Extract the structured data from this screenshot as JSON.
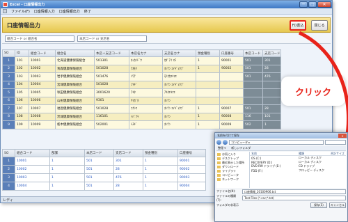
{
  "window": {
    "title": "Excel - 口座情報出力",
    "controls": [
      "─",
      "□",
      "✕"
    ]
  },
  "menu": [
    "ファイル(F)",
    "口座情報入力",
    "口座情報出力",
    "終了"
  ],
  "header": {
    "title": "口座情報出力",
    "fd_button": "FD書込",
    "close_button": "閉じる"
  },
  "search": {
    "union_label": "組合コード or 組合名",
    "branch_label": "本店コード or 支店名"
  },
  "grid1": {
    "columns": [
      "SO",
      "ID",
      "組合コード",
      "組合名",
      "本店＋支店コード",
      "本店名カナ",
      "支店名カナ",
      "預金種別",
      "口座番号",
      "本店コード",
      "支店コード"
    ],
    "rows": [
      [
        "1",
        "101",
        "10001",
        "北海道健康保険組合",
        "501301",
        "ﾎｯｶｲﾄﾞｳ",
        "ｶﾀﾞｱｲ ﾏﾁ",
        "1",
        "90001",
        "501",
        "301"
      ],
      [
        "2",
        "102",
        "10002",
        "青森健康保険組合",
        "501028",
        "ｱｵﾓﾘ",
        "ﾎﾝﾃﾝ ｴｲｷﾞｮｳﾌﾞ",
        "1",
        "90002",
        "501",
        "28"
      ],
      [
        "3",
        "103",
        "10003",
        "岩手健康保険組合",
        "501476",
        "ｲﾜﾃ",
        "ﾓﾘｵｶｴｷﾏｴ",
        "",
        "",
        "501",
        "476"
      ],
      [
        "4",
        "104",
        "10004",
        "宮城健康保険組合",
        "501028",
        "ﾐﾔｷﾞ",
        "ﾎﾝﾃﾝ ｴｲｷﾞｮｳﾌﾞ",
        "",
        "",
        "",
        ""
      ],
      [
        "5",
        "105",
        "10005",
        "秋田健康保険組合",
        "3001620",
        "ｱｷﾀ",
        "ｱｷﾀｴｷﾏｴ",
        "",
        "",
        "",
        ""
      ],
      [
        "6",
        "106",
        "10006",
        "山形健康保険組合",
        "9301",
        "ﾔﾏｶﾞﾀ",
        "ﾎﾝﾃﾝ",
        "",
        "",
        "",
        ""
      ],
      [
        "7",
        "107",
        "10007",
        "福島健康保険組合",
        "501028",
        "ﾌｸｼﾏ",
        "ﾎﾝﾃﾝ ｴｲｷﾞｮｳﾌﾞ",
        "1",
        "90007",
        "501",
        "28"
      ],
      [
        "8",
        "108",
        "10008",
        "茨城健康保険組合",
        "116101",
        "ｲﾊﾞﾗｷ",
        "ﾎﾝﾃﾝ",
        "1",
        "90008",
        "116",
        "101"
      ],
      [
        "9",
        "109",
        "10009",
        "栃木健康保険組合",
        "502001",
        "ﾄﾁｷﾞ",
        "ﾎﾝﾃﾝ",
        "1",
        "90009",
        "502",
        "1"
      ]
    ]
  },
  "grid2": {
    "columns": [
      "SO",
      "組合コード",
      "部課",
      "本店コード",
      "支店コード",
      "預金種別",
      "口座番号"
    ],
    "rows": [
      [
        "1",
        "10001",
        "1",
        "501",
        "301",
        "1",
        "90001"
      ],
      [
        "2",
        "10002",
        "1",
        "501",
        "28",
        "1",
        "90002"
      ],
      [
        "3",
        "10003",
        "1",
        "501",
        "476",
        "1",
        "90003"
      ],
      [
        "4",
        "10004",
        "1",
        "501",
        "28",
        "1",
        "90004"
      ]
    ]
  },
  "status": "レディ",
  "callout": "クリック",
  "dialog": {
    "title": "名前を付けて保存",
    "close": "✕",
    "address": "コンピュータ ▸",
    "toolbar": [
      "整理 ▾",
      "新しいフォルダ"
    ],
    "nav_items": [
      "お気に入り",
      "デスクトップ",
      "最近表示した場所",
      "ダウンロード",
      "ライブラリ",
      "コンピュータ",
      "ネットワーク"
    ],
    "list_headers": [
      "名前",
      "種類",
      "合計サイズ"
    ],
    "list_rows": [
      [
        "OS (C:)",
        "ローカル ディスク",
        ""
      ],
      [
        "RECOVERY (D:)",
        "ローカル ディスク",
        ""
      ],
      [
        "DVD RW ドライブ (E:)",
        "CD ドライブ",
        ""
      ],
      [
        "FDD (F:)",
        "フロッピー ディスク",
        ""
      ]
    ],
    "filename_label": "ファイル名(N):",
    "filename_value": "口座情報_20100906.txt",
    "filetype_label": "ファイルの種類(T):",
    "filetype_value": "Text Files (*.csv;*.txt)",
    "hide_folders": "フォルダの非表示",
    "save_button": "保存(S)",
    "cancel_button": "キャンセル"
  }
}
